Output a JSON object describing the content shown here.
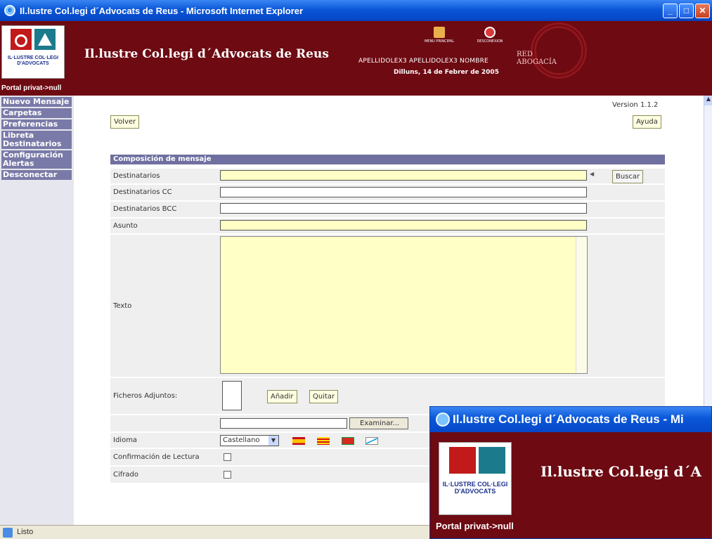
{
  "window": {
    "title": "Il.lustre Col.legi d´Advocats de Reus - Microsoft Internet Explorer"
  },
  "header": {
    "logo_text": "IL·LUSTRE COL·LEGI D'ADVOCATS",
    "portal": "Portal privat->null",
    "site_title": "Il.lustre Col.legi d´Advocats de Reus",
    "menu_principal": "MENU PRINCIPAL",
    "desconexion": "DESCONEXION",
    "user": "APELLIDOLEX3 APELLIDOLEX3 NOMBRE",
    "date": "Dilluns, 14 de Febrer de 2005",
    "red_logo": "RED ABOGACÍA"
  },
  "sidebar": {
    "items": [
      {
        "label": "Nuevo Mensaje"
      },
      {
        "label": "Carpetas"
      },
      {
        "label": "Preferencias"
      },
      {
        "label": "Libreta Destinatarios"
      },
      {
        "label": "Configuración Alertas"
      },
      {
        "label": "Desconectar"
      }
    ]
  },
  "content": {
    "version": "Version 1.1.2",
    "volver": "Volver",
    "ayuda": "Ayuda",
    "form_title": "Composición de mensaje",
    "destinatarios": "Destinatarios",
    "buscar": "Buscar",
    "destinatarios_cc": "Destinatarios CC",
    "destinatarios_bcc": "Destinatarios BCC",
    "asunto": "Asunto",
    "texto": "Texto",
    "ficheros": "Ficheros Adjuntos:",
    "anadir": "Añadir",
    "quitar": "Quitar",
    "examinar": "Examinar...",
    "idioma": "Idioma",
    "idioma_value": "Castellano",
    "confirmacion": "Confirmación de Lectura",
    "cifrado": "Cifrado"
  },
  "status": {
    "text": "Listo"
  },
  "window2": {
    "title": "Il.lustre Col.legi d´Advocats de Reus - Mi",
    "site_title": "Il.lustre Col.legi d´A",
    "portal": "Portal privat->null"
  }
}
